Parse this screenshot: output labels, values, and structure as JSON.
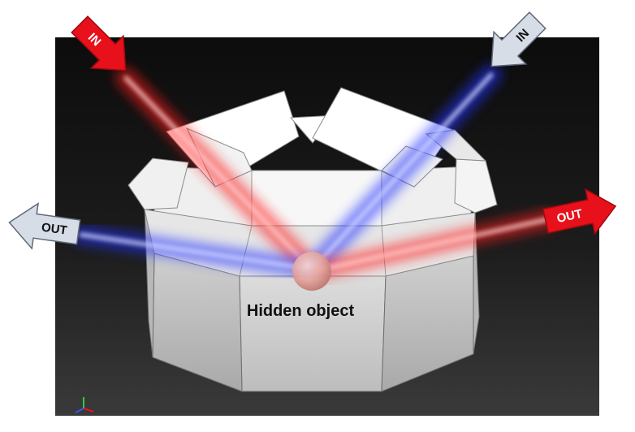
{
  "labels": {
    "in_left": "IN",
    "in_right": "IN",
    "out_left": "OUT",
    "out_right": "OUT",
    "hidden_object": "Hidden object"
  },
  "colors": {
    "red_beam": "#ff1e1e",
    "blue_beam": "#2233ff",
    "red_arrow": "#e8101a",
    "grey_arrow": "#d7dde6",
    "viewport_background": "#1c1c1c"
  },
  "icons": {
    "axis_triad": "axis-triad-icon"
  }
}
